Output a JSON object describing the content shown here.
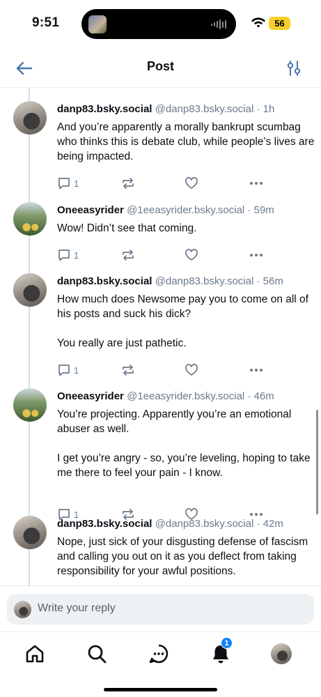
{
  "status_bar": {
    "time": "9:51",
    "battery": "56"
  },
  "header": {
    "title": "Post"
  },
  "posts": [
    {
      "author": "danp83.bsky.social",
      "handle": "@danp83.bsky.social",
      "time": "· 1h",
      "paragraphs": [
        "And you’re apparently a morally bankrupt scumbag who thinks this is debate club, while people’s lives are being impacted."
      ],
      "reply_count": "1"
    },
    {
      "author": "Oneeasyrider",
      "handle": "@1eeasyrider.bsky.social",
      "time": "· 59m",
      "paragraphs": [
        "Wow!  Didn’t see that coming."
      ],
      "reply_count": "1"
    },
    {
      "author": "danp83.bsky.social",
      "handle": "@danp83.bsky.social",
      "time": "· 56m",
      "paragraphs": [
        "How much does Newsome pay you to come on all of his posts and suck his dick?",
        "",
        "You really are just pathetic."
      ],
      "reply_count": "1"
    },
    {
      "author": "Oneeasyrider",
      "handle": "@1eeasyrider.bsky.social",
      "time": "· 46m",
      "paragraphs": [
        "You’re projecting.  Apparently you’re an emotional abuser as well.",
        "",
        "I get you’re angry - so, you’re leveling, hoping to take me there to feel your pain - I know."
      ],
      "reply_count": "1"
    },
    {
      "author": "danp83.bsky.social",
      "handle": "@danp83.bsky.social",
      "time": "· 42m",
      "paragraphs": [
        "Nope, just sick of your disgusting defense of fascism and calling you out on it as you deflect from taking responsibility for your awful positions."
      ],
      "reply_count": ""
    }
  ],
  "composer": {
    "placeholder": "Write your reply"
  },
  "tab_bar": {
    "notifications_badge": "1"
  },
  "colors": {
    "accent": "#1083fe",
    "icon_gray": "#6b7b8c",
    "back_arrow": "#4a78b0"
  }
}
